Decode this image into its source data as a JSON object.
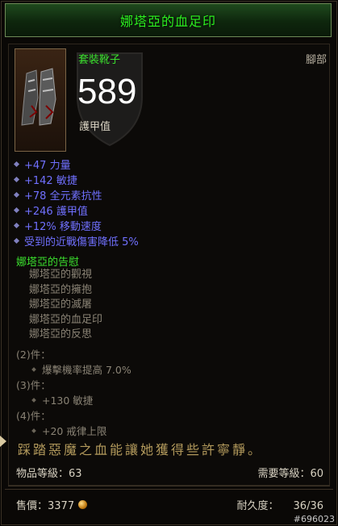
{
  "item": {
    "name": "娜塔亞的血足印",
    "type": "套裝靴子",
    "slot": "腳部",
    "armor": "589",
    "armor_label": "護甲值",
    "icon": "boots-icon"
  },
  "stats": [
    {
      "text": "+47 力量"
    },
    {
      "text": "+142 敏捷"
    },
    {
      "text": "+78 全元素抗性"
    },
    {
      "text": "+246 護甲值"
    },
    {
      "text": "+12% 移動速度"
    },
    {
      "text": "受到的近戰傷害降低 5%"
    }
  ],
  "set": {
    "name": "娜塔亞的告慰",
    "pieces": [
      "娜塔亞的觀視",
      "娜塔亞的擁抱",
      "娜塔亞的滅屠",
      "娜塔亞的血足印",
      "娜塔亞的反思"
    ],
    "bonuses": [
      {
        "header": "(2)件：",
        "line": "爆擊機率提高 7.0%"
      },
      {
        "header": "(3)件：",
        "line": "+130 敏捷"
      },
      {
        "header": "(4)件：",
        "line": "+20 戒律上限"
      }
    ]
  },
  "flavor": "踩踏惡魔之血能讓她獲得些許寧靜。",
  "item_level": "物品等級：63",
  "required_level": "需要等級：60",
  "price": "售價：3377",
  "durability_label": "耐久度：",
  "durability_value": "36/36",
  "watermark": "#696023",
  "colors": {
    "set_green": "#3be02e",
    "magic_blue": "#7070ff",
    "flavor_gold": "#b39a5c"
  }
}
